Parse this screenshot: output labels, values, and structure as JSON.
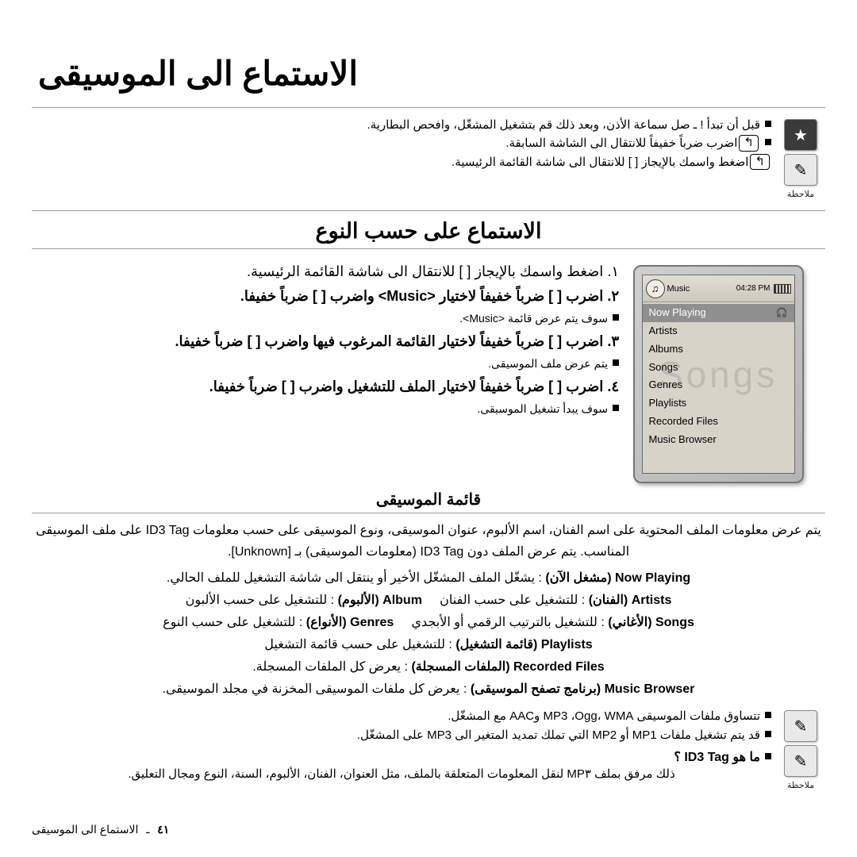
{
  "document": {
    "title": "الاستماع الى الموسيقى",
    "footer": {
      "page": "٤١",
      "dash": "ـ",
      "label": "الاستماع الى الموسيقى"
    }
  },
  "top_note": {
    "caption": "ملاحظة",
    "icons": [
      "star-icon",
      "note-pad-icon"
    ],
    "lines": [
      "قبل أن تبدأ ! ـ صل سماعة الأذن، وبعد ذلك قم بتشغيل المشغّل، وافحص البطارية.",
      "اضرب ضرباً خفيفاً للانتقال الى الشاشة السابقة.",
      "اضغط واسمك بالإيجاز [ ] للانتقال الى شاشة القائمة الرئيسية."
    ]
  },
  "section": {
    "title": "الاستماع على حسب النوع"
  },
  "device": {
    "clock": "04:28 PM",
    "logo_label": "Music",
    "watermark": "Songs",
    "items": [
      {
        "label": "Now Playing",
        "selected": true,
        "icon": "headphones-icon"
      },
      {
        "label": "Artists",
        "selected": false,
        "icon": ""
      },
      {
        "label": "Albums",
        "selected": false,
        "icon": ""
      },
      {
        "label": "Songs",
        "selected": false,
        "icon": ""
      },
      {
        "label": "Genres",
        "selected": false,
        "icon": ""
      },
      {
        "label": "Playlists",
        "selected": false,
        "icon": ""
      },
      {
        "label": "Recorded Files",
        "selected": false,
        "icon": ""
      },
      {
        "label": "Music Browser",
        "selected": false,
        "icon": ""
      }
    ]
  },
  "steps": [
    {
      "num": "١.",
      "text": "اضغط واسمك بالإيجاز [ ] للانتقال الى شاشة القائمة الرئيسية.",
      "subs": []
    },
    {
      "num": "٢.",
      "text": "اضرب [ ] ضرباً خفيفاً لاختيار <Music> واضرب [ ] ضرباً خفيفا.",
      "subs": [
        "سوف يتم عرض قائمة <Music>."
      ]
    },
    {
      "num": "٣.",
      "text": "اضرب [ ] ضرباً خفيفاً لاختيار القائمة المرغوب فيها واضرب [ ] ضرباً خفيفا.",
      "subs": [
        "يتم عرض ملف الموسيقى."
      ]
    },
    {
      "num": "٤.",
      "text": "اضرب [ ] ضرباً خفيفاً لاختيار الملف للتشغيل واضرب [ ] ضرباً خفيفا.",
      "subs": [
        "سوف يبدأ تشغيل الموسيقى."
      ]
    }
  ],
  "music_list": {
    "title": "قائمة الموسيقى",
    "paragraph_1": "يتم عرض معلومات الملف المحتوية على اسم الفنان، اسم الألبوم، عنوان الموسيقى، ونوع الموسيقى على حسب معلومات ID3 Tag على ملف الموسيقى المناسب. يتم عرض الملف دون ID3 Tag (معلومات الموسيقى) بـ [Unknown].",
    "definitions": [
      {
        "en": "Now Playing",
        "ar": "(مشغل الآن)",
        "desc": ": يشغّل الملف المشغّل الأخير أو ينتقل الى شاشة التشغيل للملف الحالي."
      },
      {
        "en": "Artists",
        "ar": "(الفنان)",
        "desc": ": للتشغيل على حسب الفنان"
      },
      {
        "en": "Album",
        "ar": "(الألبوم)",
        "desc": ": للتشغيل على حسب الألبون"
      },
      {
        "en": "Songs",
        "ar": "(الأغاني)",
        "desc": ": للتشغيل بالترتيب الرقمي أو الأبجدي"
      },
      {
        "en": "Genres",
        "ar": "(الأنواع)",
        "desc": ": للتشغيل على حسب النوع"
      },
      {
        "en": "Playlists",
        "ar": "(قائمة التشغيل)",
        "desc": ": للتشغيل على حسب قائمة التشغيل"
      },
      {
        "en": "Recorded Files",
        "ar": "(الملفات المسجلة)",
        "desc": ": يعرض كل الملفات المسجلة."
      },
      {
        "en": "Music Browser",
        "ar": "(برنامج تصفح الموسيقى)",
        "desc": ": يعرض كل ملفات الموسيقى المخزنة في مجلد الموسيقى."
      }
    ]
  },
  "bottom_note": {
    "caption": "ملاحظة",
    "icons": [
      "note-pad-icon-1",
      "note-pad-icon-2"
    ],
    "lines": [
      "تتساوق ملفات الموسيقى MP3 ،Ogg، WMA وAAC مع المشغّل.",
      "قد يتم تشغيل ملفات MP1 أو MP2 التي تملك تمديد المتغير الى MP3 على المشغّل."
    ]
  },
  "question": {
    "q": "ما هو ID3 Tag ؟",
    "a": "ذلك مرفق بملف MP٣ لنقل المعلومات المتعلقة بالملف، مثل العنوان، الفنان، الألبوم، السنة، النوع ومجال التعليق."
  }
}
